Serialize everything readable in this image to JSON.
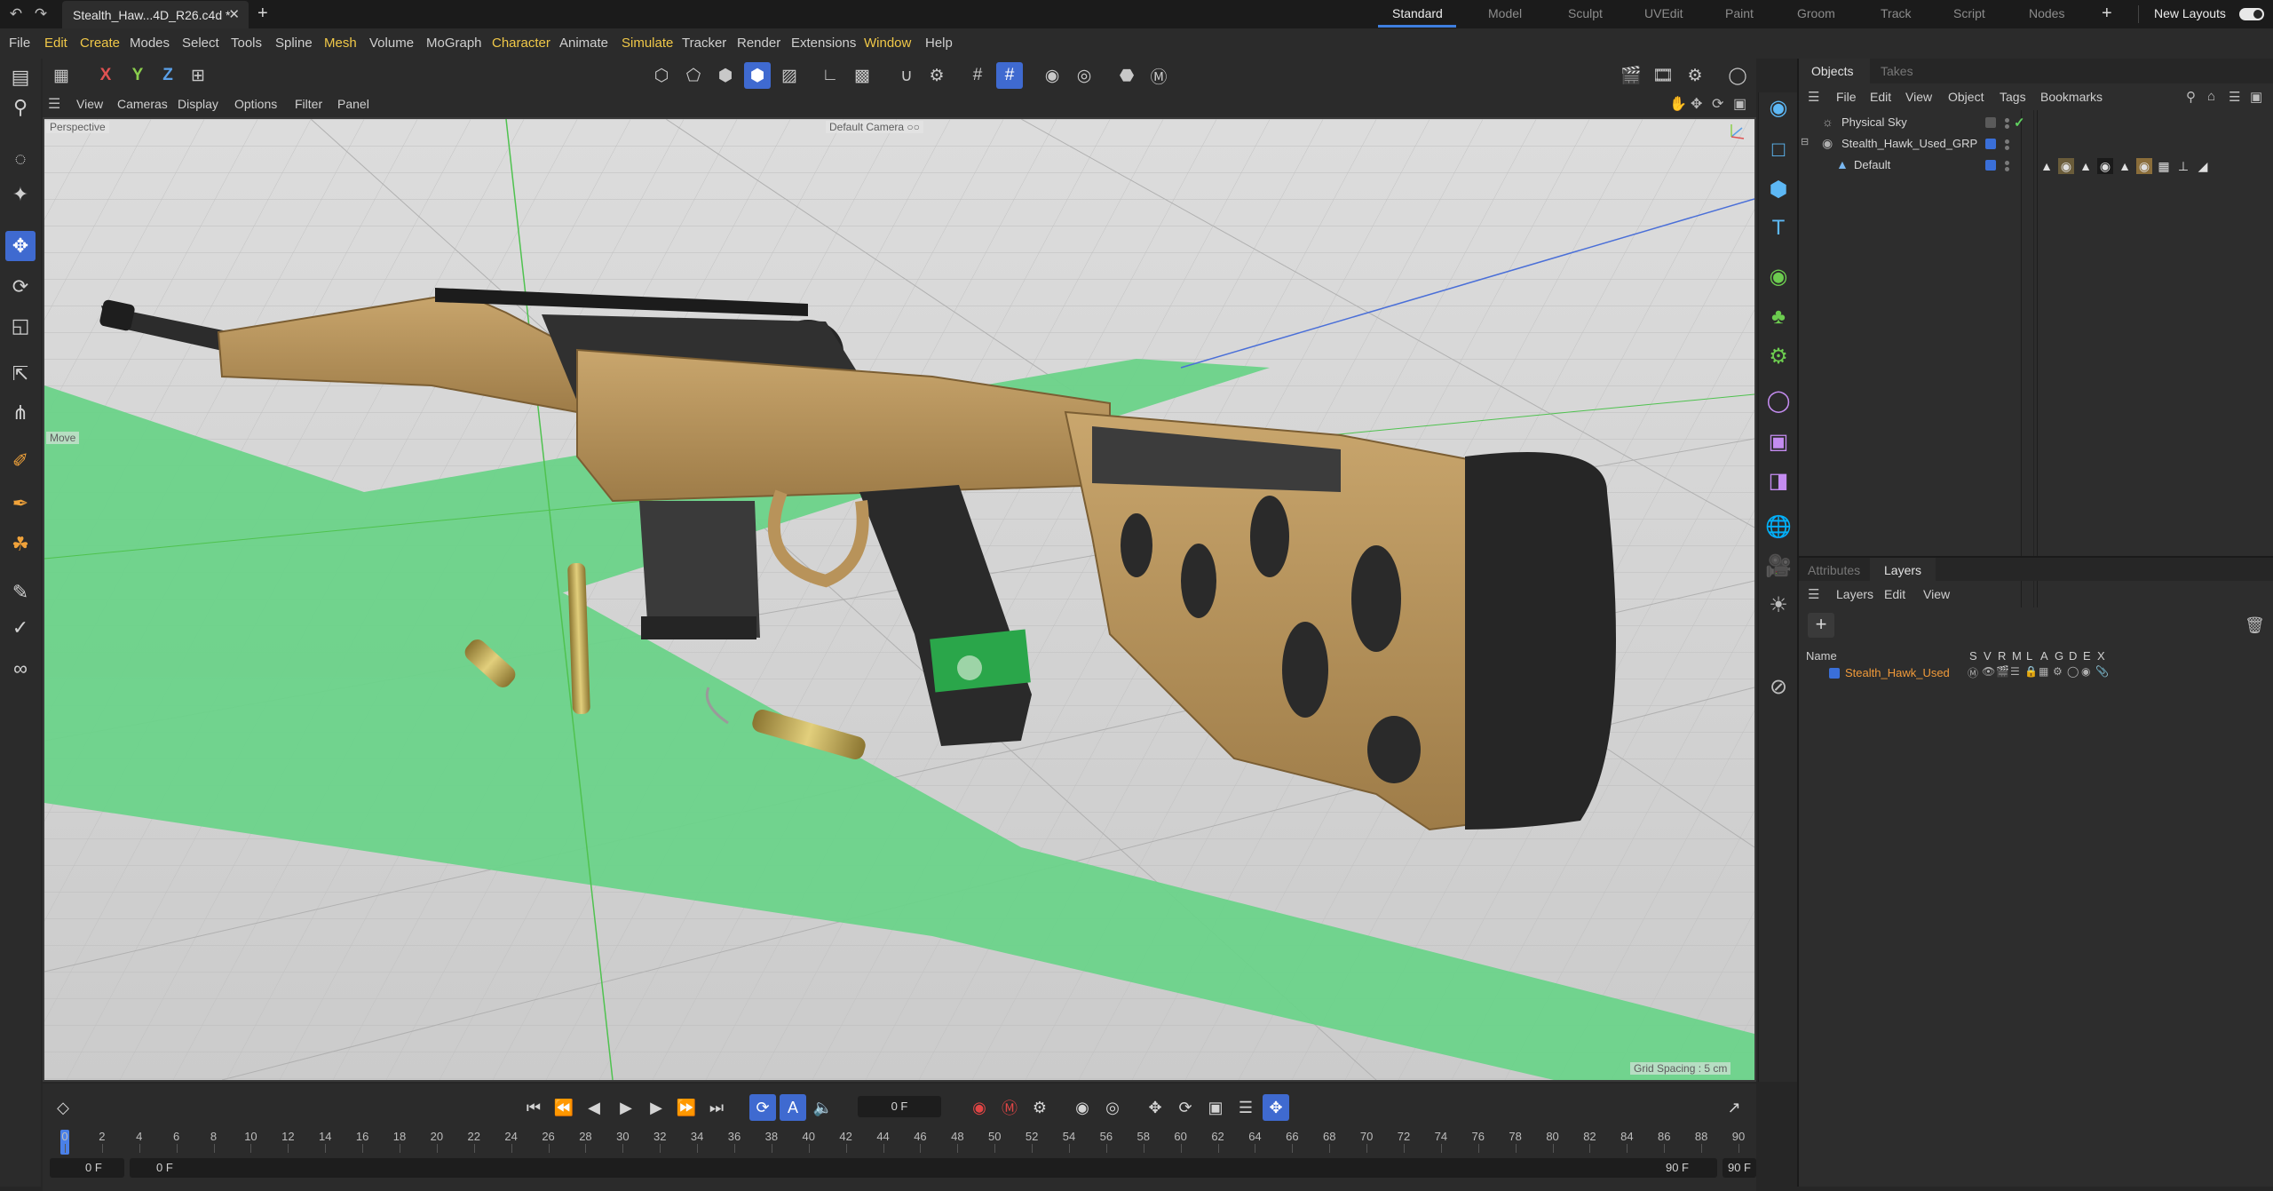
{
  "titlebar": {
    "doc_tab": "Stealth_Haw...4D_R26.c4d *",
    "layouts": [
      "Standard",
      "Model",
      "Sculpt",
      "UVEdit",
      "Paint",
      "Groom",
      "Track",
      "Script",
      "Nodes"
    ],
    "active_layout": "Standard",
    "new_layouts": "New Layouts"
  },
  "menubar": {
    "items": [
      "File",
      "Edit",
      "Create",
      "Modes",
      "Select",
      "Tools",
      "Spline",
      "Mesh",
      "Volume",
      "MoGraph",
      "Character",
      "Animate",
      "Simulate",
      "Tracker",
      "Render",
      "Extensions",
      "Window",
      "Help"
    ],
    "highlighted": [
      "Edit",
      "Create",
      "Mesh",
      "Character",
      "Simulate",
      "Window"
    ]
  },
  "viewport": {
    "menu": [
      "View",
      "Cameras",
      "Display",
      "Options",
      "Filter",
      "Panel"
    ],
    "label_perspective": "Perspective",
    "label_camera": "Default Camera ○○",
    "label_move": "Move",
    "label_grid": "Grid Spacing : 5 cm"
  },
  "objects_panel": {
    "tabs": [
      "Objects",
      "Takes"
    ],
    "menu": [
      "File",
      "Edit",
      "View",
      "Object",
      "Tags",
      "Bookmarks"
    ],
    "rows": [
      {
        "name": "Physical Sky",
        "indent": 0
      },
      {
        "name": "Stealth_Hawk_Used_GRP",
        "indent": 0
      },
      {
        "name": "Default",
        "indent": 1
      }
    ]
  },
  "layers_panel": {
    "tabs": [
      "Attributes",
      "Layers"
    ],
    "menu": [
      "Layers",
      "Edit",
      "View"
    ],
    "column_name": "Name",
    "columns": [
      "S",
      "V",
      "R",
      "M",
      "L",
      "A",
      "G",
      "D",
      "E",
      "X"
    ],
    "layer": "Stealth_Hawk_Used",
    "layer_color": "#3a6fd8"
  },
  "timeline": {
    "current_frame": "0 F",
    "ruler": [
      "0",
      "2",
      "4",
      "6",
      "8",
      "10",
      "12",
      "14",
      "16",
      "18",
      "20",
      "22",
      "24",
      "26",
      "28",
      "30",
      "32",
      "34",
      "36",
      "38",
      "40",
      "42",
      "44",
      "46",
      "48",
      "50",
      "52",
      "54",
      "56",
      "58",
      "60",
      "62",
      "64",
      "66",
      "68",
      "70",
      "72",
      "74",
      "76",
      "78",
      "80",
      "82",
      "84",
      "86",
      "88",
      "90"
    ],
    "range_start": "0 F",
    "range_start2": "0 F",
    "range_end": "90 F",
    "range_end2": "90 F"
  },
  "colors": {
    "accent": "#3f6ad0",
    "highlight_menu": "#f0c848",
    "layer_name": "#f09a3a",
    "green_plane": "#6cd38a",
    "stock_tan": "#b8935a"
  }
}
